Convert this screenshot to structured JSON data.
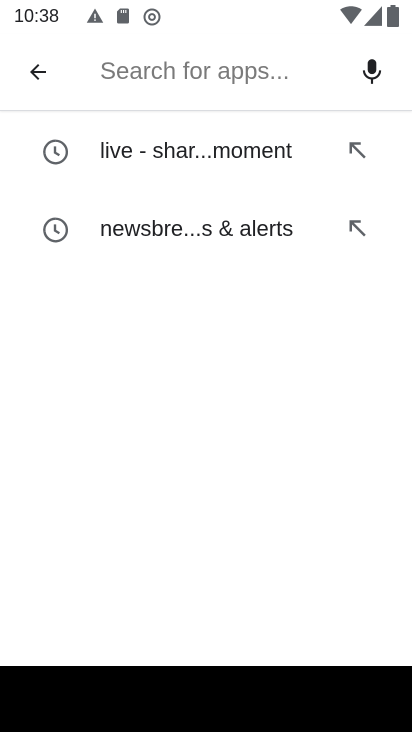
{
  "status_bar": {
    "time": "10:38"
  },
  "search": {
    "placeholder": "Search for apps...",
    "value": ""
  },
  "suggestions": [
    {
      "label": "live - shar...moment"
    },
    {
      "label": "newsbre...s & alerts"
    }
  ],
  "colors": {
    "icon": "#5f6368",
    "text": "#202124",
    "placeholder": "#7a7a7a",
    "nav_bar": "#000000"
  }
}
